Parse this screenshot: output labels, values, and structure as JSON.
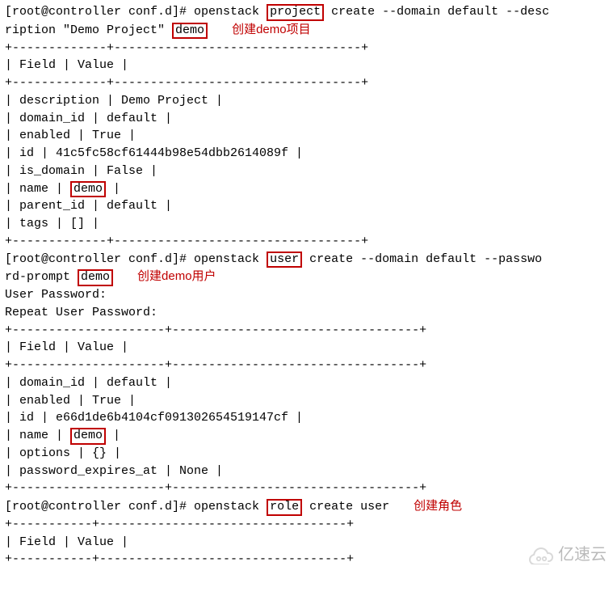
{
  "prompt1": "[root@controller conf.d]# ",
  "cmd1_pre": "openstack ",
  "cmd1_box": "project",
  "cmd1_post": " create --domain default --desc",
  "cmd1_line2_pre": "ription \"Demo Project\" ",
  "cmd1_line2_box": "demo",
  "annot1": "创建demo项目",
  "table1": {
    "border_top": "+-------------+----------------------------------+",
    "header": "| Field       | Value                            |",
    "border_mid": "+-------------+----------------------------------+",
    "rows": {
      "r1": "| description | Demo Project                     |",
      "r2": "| domain_id   | default                          |",
      "r3": "| enabled     | True                             |",
      "r4": "| id          | 41c5fc58cf61444b98e54dbb2614089f |",
      "r5": "| is_domain   | False                            |",
      "r6_pre": "| name        | ",
      "r6_box": "demo",
      "r6_post": "                             |",
      "r7": "| parent_id   | default                          |",
      "r8": "| tags        | []                               |"
    },
    "border_bot": "+-------------+----------------------------------+"
  },
  "prompt2": "[root@controller conf.d]# ",
  "cmd2_pre": "openstack ",
  "cmd2_box": "user",
  "cmd2_post": " create --domain default  --passwo",
  "cmd2_line2_pre": "rd-prompt ",
  "cmd2_line2_box": "demo",
  "annot2": "创建demo用户",
  "pw_prompt": "User Password:",
  "pw_repeat": "Repeat User Password:",
  "table2": {
    "border_top": "+---------------------+----------------------------------+",
    "header": "| Field               | Value                            |",
    "border_mid": "+---------------------+----------------------------------+",
    "rows": {
      "r1": "| domain_id           | default                          |",
      "r2": "| enabled             | True                             |",
      "r3": "| id                  | e66d1de6b4104cf091302654519147cf |",
      "r4_pre": "| name                | ",
      "r4_box": "demo",
      "r4_post": "                             |",
      "r5": "| options             | {}                               |",
      "r6": "| password_expires_at | None                             |"
    },
    "border_bot": "+---------------------+----------------------------------+"
  },
  "prompt3": "[root@controller conf.d]# ",
  "cmd3_pre": "openstack ",
  "cmd3_box": "role",
  "cmd3_post": " create user",
  "annot3": "创建角色",
  "table3": {
    "border_top": "+-----------+----------------------------------+",
    "header": "| Field     | Value                            |",
    "border_mid": "+-----------+----------------------------------+"
  },
  "watermark": "亿速云"
}
